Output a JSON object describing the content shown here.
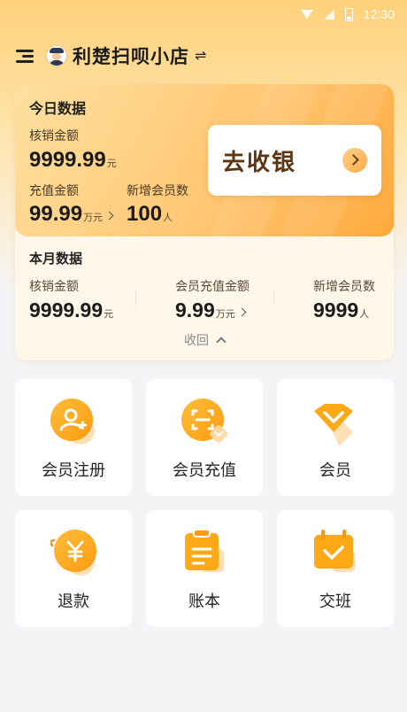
{
  "status_bar": {
    "time": "12:30"
  },
  "header": {
    "store_name": "利楚扫呗小店",
    "switch_glyph": "⇌"
  },
  "today": {
    "title": "今日数据",
    "writeoff_label": "核销金额",
    "writeoff_value": "9999.99",
    "writeoff_unit": "元",
    "recharge_label": "充值金额",
    "recharge_value": "99.99",
    "recharge_unit": "万元",
    "new_members_label": "新增会员数",
    "new_members_value": "100",
    "new_members_unit": "人",
    "cashier_label": "去收银"
  },
  "month": {
    "title": "本月数据",
    "writeoff_label": "核销金额",
    "writeoff_value": "9999.99",
    "writeoff_unit": "元",
    "recharge_label": "会员充值金额",
    "recharge_value": "9.99",
    "recharge_unit": "万元",
    "new_members_label": "新增会员数",
    "new_members_value": "9999",
    "new_members_unit": "人",
    "collapse_label": "收回"
  },
  "grid": [
    {
      "label": "会员注册",
      "icon": "member-register-icon"
    },
    {
      "label": "会员充值",
      "icon": "member-recharge-icon"
    },
    {
      "label": "会员",
      "icon": "member-icon"
    },
    {
      "label": "退款",
      "icon": "refund-icon"
    },
    {
      "label": "账本",
      "icon": "ledger-icon"
    },
    {
      "label": "交班",
      "icon": "shift-handover-icon"
    }
  ],
  "colors": {
    "accent": "#ffa93c",
    "accent_light": "#ffe0a0",
    "text_dark": "#1b1b1b"
  }
}
